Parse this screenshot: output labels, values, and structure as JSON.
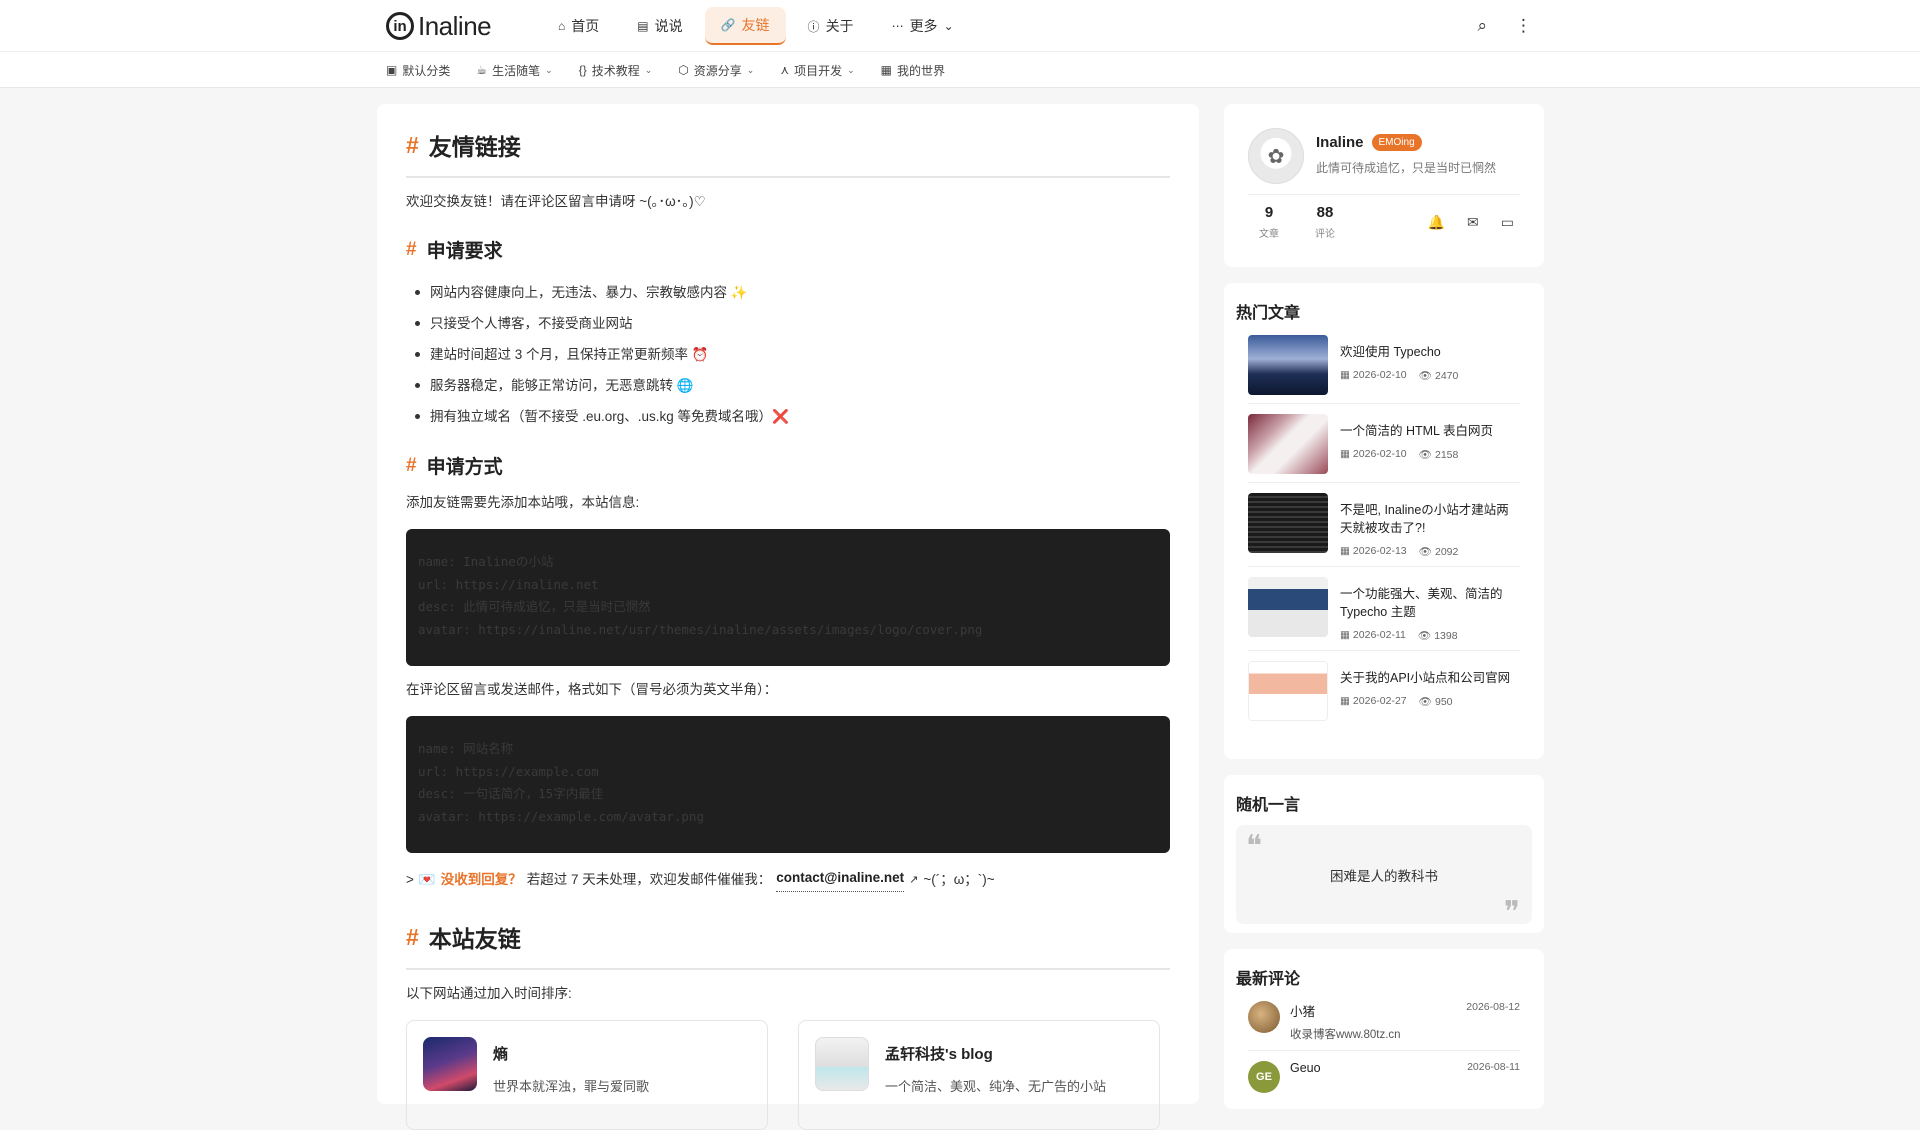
{
  "brand": {
    "logo_mark": "in",
    "name": "Inaline"
  },
  "nav": [
    {
      "label": "首页",
      "icon": "⌂"
    },
    {
      "label": "说说",
      "icon": "▤"
    },
    {
      "label": "友链",
      "icon": "🔗"
    },
    {
      "label": "关于",
      "icon": "ⓘ"
    },
    {
      "label": "更多",
      "icon": "⋯",
      "caret": "⌄"
    }
  ],
  "topbar": {
    "search_icon": "⌕",
    "more_icon": "⋮"
  },
  "subnav": [
    {
      "label": "默认分类",
      "icon": "▣"
    },
    {
      "label": "生活随笔",
      "icon": "☕",
      "caret": "⌄"
    },
    {
      "label": "技术教程",
      "icon": "{}",
      "caret": "⌄"
    },
    {
      "label": "资源分享",
      "icon": "⬡",
      "caret": "⌄"
    },
    {
      "label": "项目开发",
      "icon": "⋏",
      "caret": "⌄"
    },
    {
      "label": "我的世界",
      "icon": "▦"
    }
  ],
  "article": {
    "hash": "#",
    "title": "友情链接",
    "intro": "欢迎交换友链！请在评论区留言申请呀 ~(｡･ω･｡)♡",
    "req_title": "申请要求",
    "requirements": [
      "网站内容健康向上，无违法、暴力、宗教敏感内容 ✨",
      "只接受个人博客，不接受商业网站",
      "建站时间超过 3 个月，且保持正常更新频率 ⏰",
      "服务器稳定，能够正常访问，无恶意跳转 🌐",
      "拥有独立域名（暂不接受 .eu.org、.us.kg 等免费域名哦）❌"
    ],
    "apply_title": "申请方式",
    "apply_intro": "添加友链需要先添加本站哦，本站信息:",
    "site_code": "name: Inalineの小站\nurl: https://inaline.net\ndesc: 此情可待成追忆，只是当时已惘然\navatar: https://inaline.net/usr/themes/inaline/assets/images/logo/cover.png",
    "format_intro": "在评论区留言或发送邮件，格式如下（冒号必须为英文半角）：",
    "format_code": "name: 网站名称\nurl: https://example.com\ndesc: 一句话简介，15字内最佳\navatar: https://example.com/avatar.png",
    "note": {
      "prefix": ">",
      "icon": "💌",
      "highlight": "没收到回复？",
      "text": "若超过 7 天未处理，欢迎发邮件催催我：",
      "email": "contact@inaline.net",
      "ext_icon": "↗",
      "suffix": "~(´；ω；`)~"
    },
    "friends_title": "本站友链",
    "friends_intro": "以下网站通过加入时间排序:",
    "friends": [
      {
        "name": "熵",
        "desc": "世界本就浑浊，罪与爱同歌"
      },
      {
        "name": "孟轩科技's blog",
        "desc": "一个简洁、美观、纯净、无广告的小站"
      }
    ]
  },
  "profile": {
    "avatar_icon": "✿",
    "name": "Inaline",
    "badge": "EMOing",
    "bio": "此情可待成追忆，只是当时已惘然",
    "stats": [
      {
        "num": "9",
        "label": "文章"
      },
      {
        "num": "88",
        "label": "评论"
      }
    ],
    "icons": [
      "🔔",
      "✉",
      "▭"
    ]
  },
  "hot": {
    "title": "热门文章",
    "items": [
      {
        "title": "欢迎使用 Typecho",
        "date": "2026-02-10",
        "views": "2470"
      },
      {
        "title": "一个简洁的 HTML 表白网页",
        "date": "2026-02-10",
        "views": "2158"
      },
      {
        "title": "不是吧, Inalineの小站才建站两天就被攻击了?!",
        "date": "2026-02-13",
        "views": "2092"
      },
      {
        "title": "一个功能强大、美观、简洁的 Typecho 主题",
        "date": "2026-02-11",
        "views": "1398"
      },
      {
        "title": "关于我的API小站点和公司官网",
        "date": "2026-02-27",
        "views": "950"
      }
    ],
    "date_icon": "▦",
    "views_icon": "👁"
  },
  "quote": {
    "title": "随机一言",
    "open": "❝",
    "close": "❞",
    "text": "困难是人的教科书"
  },
  "comments": {
    "title": "最新评论",
    "items": [
      {
        "user": "小猪",
        "date": "2026-08-12",
        "text": "收录博客www.80tz.cn",
        "initials": ""
      },
      {
        "user": "Geuo",
        "date": "2026-08-11",
        "text": "",
        "initials": "GE"
      }
    ]
  }
}
